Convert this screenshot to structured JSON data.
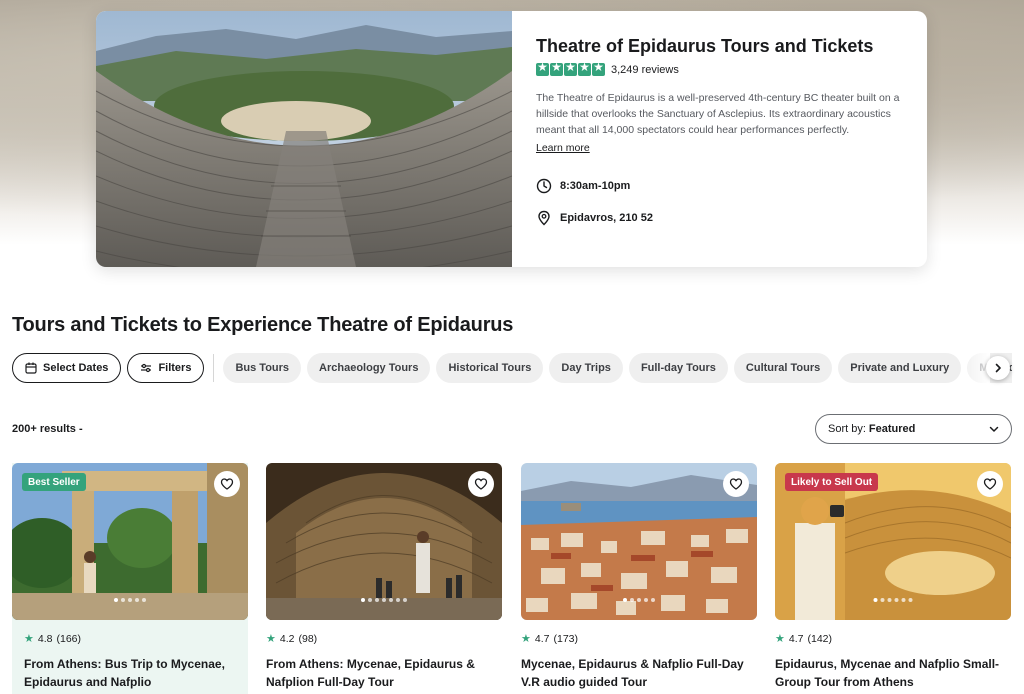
{
  "hero": {
    "title": "Theatre of Epidaurus Tours and Tickets",
    "rating_stars": 5,
    "reviews": "3,249 reviews",
    "description": "The Theatre of Epidaurus is a well-preserved 4th-century BC theater built on a hillside that overlooks the Sanctuary of Asclepius. Its extraordinary acoustics meant that all 14,000 spectators could hear performances perfectly.",
    "learn_more": "Learn more",
    "hours": "8:30am-10pm",
    "location": "Epidavros, 210 52",
    "icons": [
      "clock-icon",
      "map-pin-icon",
      "star-icon"
    ]
  },
  "section": {
    "title": "Tours and Tickets to Experience Theatre of Epidaurus"
  },
  "filters": {
    "select_dates": "Select Dates",
    "filters": "Filters",
    "chips": [
      "Bus Tours",
      "Archaeology Tours",
      "Historical Tours",
      "Day Trips",
      "Full-day Tours",
      "Cultural Tours",
      "Private and Luxury",
      "Multi-day Tours"
    ]
  },
  "results": {
    "count": "200+ results -",
    "sort_prefix": "Sort by:",
    "sort_value": "Featured"
  },
  "cards": [
    {
      "badge": "Best Seller",
      "rating": "4.8",
      "count": "(166)",
      "title": "From Athens: Bus Trip to Mycenae, Epidaurus and Nafplio"
    },
    {
      "badge": "",
      "rating": "4.2",
      "count": "(98)",
      "title": "From Athens: Mycenae, Epidaurus & Nafplion Full-Day Tour"
    },
    {
      "badge": "",
      "rating": "4.7",
      "count": "(173)",
      "title": "Mycenae, Epidaurus & Nafplio Full-Day V.R audio guided Tour"
    },
    {
      "badge": "Likely to Sell Out",
      "rating": "4.7",
      "count": "(142)",
      "title": "Epidaurus, Mycenae and Nafplio Small-Group Tour from Athens"
    }
  ],
  "colors": {
    "accent_green": "#34a37c",
    "badge_red": "#c8384c",
    "text": "#1a1b1d",
    "chip_bg": "#efefef"
  }
}
